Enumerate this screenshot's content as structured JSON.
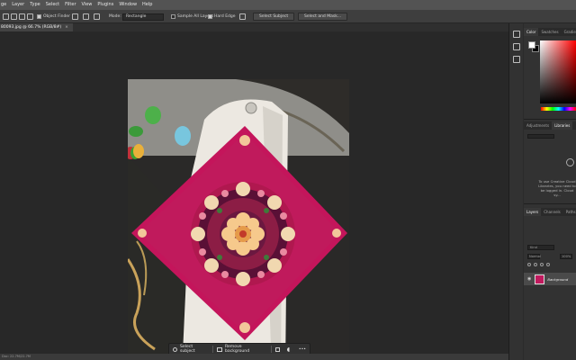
{
  "menu": [
    "ge",
    "Layer",
    "Type",
    "Select",
    "Filter",
    "View",
    "Plugins",
    "Window",
    "Help"
  ],
  "options": {
    "object_finder": "Object Finder",
    "mode_label": "Mode:",
    "mode_value": "Rectangle",
    "sample_all_layers": "Sample All Layers",
    "hard_edge": "Hard Edge",
    "select_subject": "Select Subject",
    "select_and_mask": "Select and Mask..."
  },
  "document_tab": {
    "title": "80093.jpg @ 66.7% (RGB/8#)",
    "close": "×"
  },
  "taskbar": {
    "select_subject": "Select subject",
    "remove_background": "Remove background",
    "more": "•••"
  },
  "status": "Doc: 22.7M/22.7M",
  "panels": {
    "color_tabs": [
      "Color",
      "Swatches",
      "Gradients"
    ],
    "adjust_tabs": [
      "Adjustments",
      "Libraries"
    ],
    "libraries_message": "To use Creative Cloud Libraries, you need to be logged in. Cloud sy...",
    "layers_tabs": [
      "Layers",
      "Channels",
      "Paths"
    ],
    "search_placeholder": "Kind",
    "blend_mode": "Normal",
    "opacity": "100%",
    "layer_name": "Background"
  },
  "colors": {
    "accent_pink": "#c4155b",
    "ui_dark": "#2b2b2b"
  }
}
